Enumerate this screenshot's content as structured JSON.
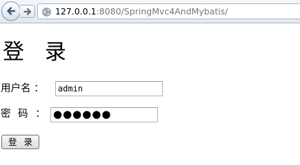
{
  "browser": {
    "address": {
      "host": "127.0.0.1",
      "rest": ":8080/SpringMvc4AndMybatis/"
    },
    "icons": {
      "back": "back-arrow-icon",
      "forward": "forward-arrow-icon",
      "site": "globe-icon"
    }
  },
  "page": {
    "title": "登 录",
    "username_label": "用户名 ：",
    "username_value": "admin",
    "password_label": "密 码 ：",
    "password_mask": "●●●●●●",
    "login_button": "登 录"
  }
}
